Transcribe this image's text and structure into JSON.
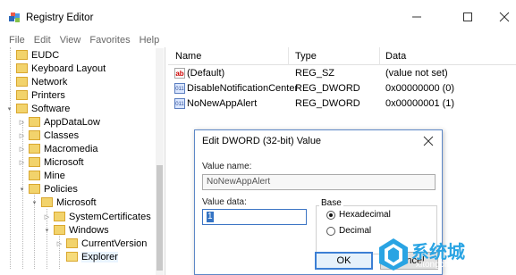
{
  "window": {
    "title": "Registry Editor",
    "menu": [
      "File",
      "Edit",
      "View",
      "Favorites",
      "Help"
    ]
  },
  "tree": [
    {
      "label": "EUDC",
      "indent": 0,
      "expander": "none"
    },
    {
      "label": "Keyboard Layout",
      "indent": 0,
      "expander": "none"
    },
    {
      "label": "Network",
      "indent": 0,
      "expander": "none"
    },
    {
      "label": "Printers",
      "indent": 0,
      "expander": "none"
    },
    {
      "label": "Software",
      "indent": 0,
      "expander": "expanded"
    },
    {
      "label": "AppDataLow",
      "indent": 1,
      "expander": "collapsed"
    },
    {
      "label": "Classes",
      "indent": 1,
      "expander": "collapsed"
    },
    {
      "label": "Macromedia",
      "indent": 1,
      "expander": "collapsed"
    },
    {
      "label": "Microsoft",
      "indent": 1,
      "expander": "collapsed"
    },
    {
      "label": "Mine",
      "indent": 1,
      "expander": "none"
    },
    {
      "label": "Policies",
      "indent": 1,
      "expander": "expanded"
    },
    {
      "label": "Microsoft",
      "indent": 2,
      "expander": "expanded"
    },
    {
      "label": "SystemCertificates",
      "indent": 3,
      "expander": "collapsed"
    },
    {
      "label": "Windows",
      "indent": 3,
      "expander": "expanded"
    },
    {
      "label": "CurrentVersion",
      "indent": 4,
      "expander": "collapsed"
    },
    {
      "label": "Explorer",
      "indent": 4,
      "expander": "none",
      "selected": true
    }
  ],
  "list": {
    "headers": {
      "name": "Name",
      "type": "Type",
      "data": "Data"
    },
    "rows": [
      {
        "icon": "string-value-icon",
        "glyph": "ab",
        "name": "(Default)",
        "type": "REG_SZ",
        "data": "(value not set)"
      },
      {
        "icon": "binary-value-icon",
        "glyph": "011",
        "name": "DisableNotificationCenter",
        "type": "REG_DWORD",
        "data": "0x00000000 (0)"
      },
      {
        "icon": "binary-value-icon",
        "glyph": "011",
        "name": "NoNewAppAlert",
        "type": "REG_DWORD",
        "data": "0x00000001 (1)"
      }
    ]
  },
  "dialog": {
    "title": "Edit DWORD (32-bit) Value",
    "value_name_label": "Value name:",
    "value_name": "NoNewAppAlert",
    "value_data_label": "Value data:",
    "value_data": "1",
    "base_label": "Base",
    "hex_label": "Hexadecimal",
    "dec_label": "Decimal",
    "ok_label": "OK",
    "cancel_label": "Cancel",
    "base_selected": "Hexadecimal"
  },
  "watermark": {
    "text": "系统城",
    "sub": "xitongcheng.com"
  },
  "colors": {
    "accent": "#3c7fd4",
    "folder": "#f2d36c",
    "watermark": "#2aa4e3"
  }
}
